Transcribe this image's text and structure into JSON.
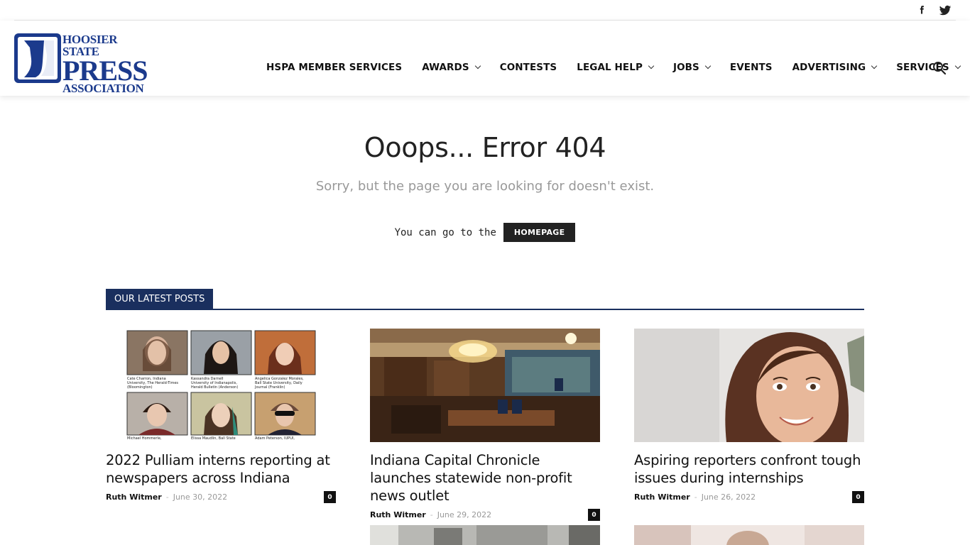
{
  "social": {
    "facebook_icon": "facebook-icon",
    "twitter_icon": "twitter-icon"
  },
  "logo": {
    "line1": "HOOSIER STATE",
    "line2": "PRESS",
    "line3": "ASSOCIATION"
  },
  "nav": [
    {
      "label": "HSPA MEMBER SERVICES",
      "dropdown": false
    },
    {
      "label": "AWARDS",
      "dropdown": true
    },
    {
      "label": "CONTESTS",
      "dropdown": false
    },
    {
      "label": "LEGAL HELP",
      "dropdown": true
    },
    {
      "label": "JOBS",
      "dropdown": true
    },
    {
      "label": "EVENTS",
      "dropdown": false
    },
    {
      "label": "ADVERTISING",
      "dropdown": true
    },
    {
      "label": "SERVICES",
      "dropdown": true
    }
  ],
  "error": {
    "title": "Ooops... Error 404",
    "subtitle": "Sorry, but the page you are looking for doesn't exist.",
    "goto_text": "You can go to the",
    "button": "HOMEPAGE"
  },
  "latest": {
    "label": "OUR LATEST POSTS"
  },
  "posts": [
    {
      "title": "2022 Pulliam interns reporting at newspapers across Indiana",
      "author": "Ruth Witmer",
      "date": "June 30, 2022",
      "comments": "0",
      "captions": [
        "Cate Charron, Indiana University, The Herald-Times (Bloomington)",
        "Kassandra Darnell University of Indianapolis, Herald Bulletin (Anderson)",
        "Angelica Gonzalez Morales, Ball State University, Daily Journal (Franklin)",
        "Michael Hommerle,",
        "Elissa Maudlin, Ball State",
        "Adam Peterson, IUPUI,"
      ]
    },
    {
      "title": "Indiana Capital Chronicle launches statewide non-profit news outlet",
      "author": "Ruth Witmer",
      "date": "June 29, 2022",
      "comments": "0"
    },
    {
      "title": "Aspiring reporters confront tough issues during internships",
      "author": "Ruth Witmer",
      "date": "June 26, 2022",
      "comments": "0"
    }
  ],
  "colors": {
    "brand_blue": "#1b3a8c",
    "section_navy": "#1a2f5e",
    "dark": "#222222"
  }
}
